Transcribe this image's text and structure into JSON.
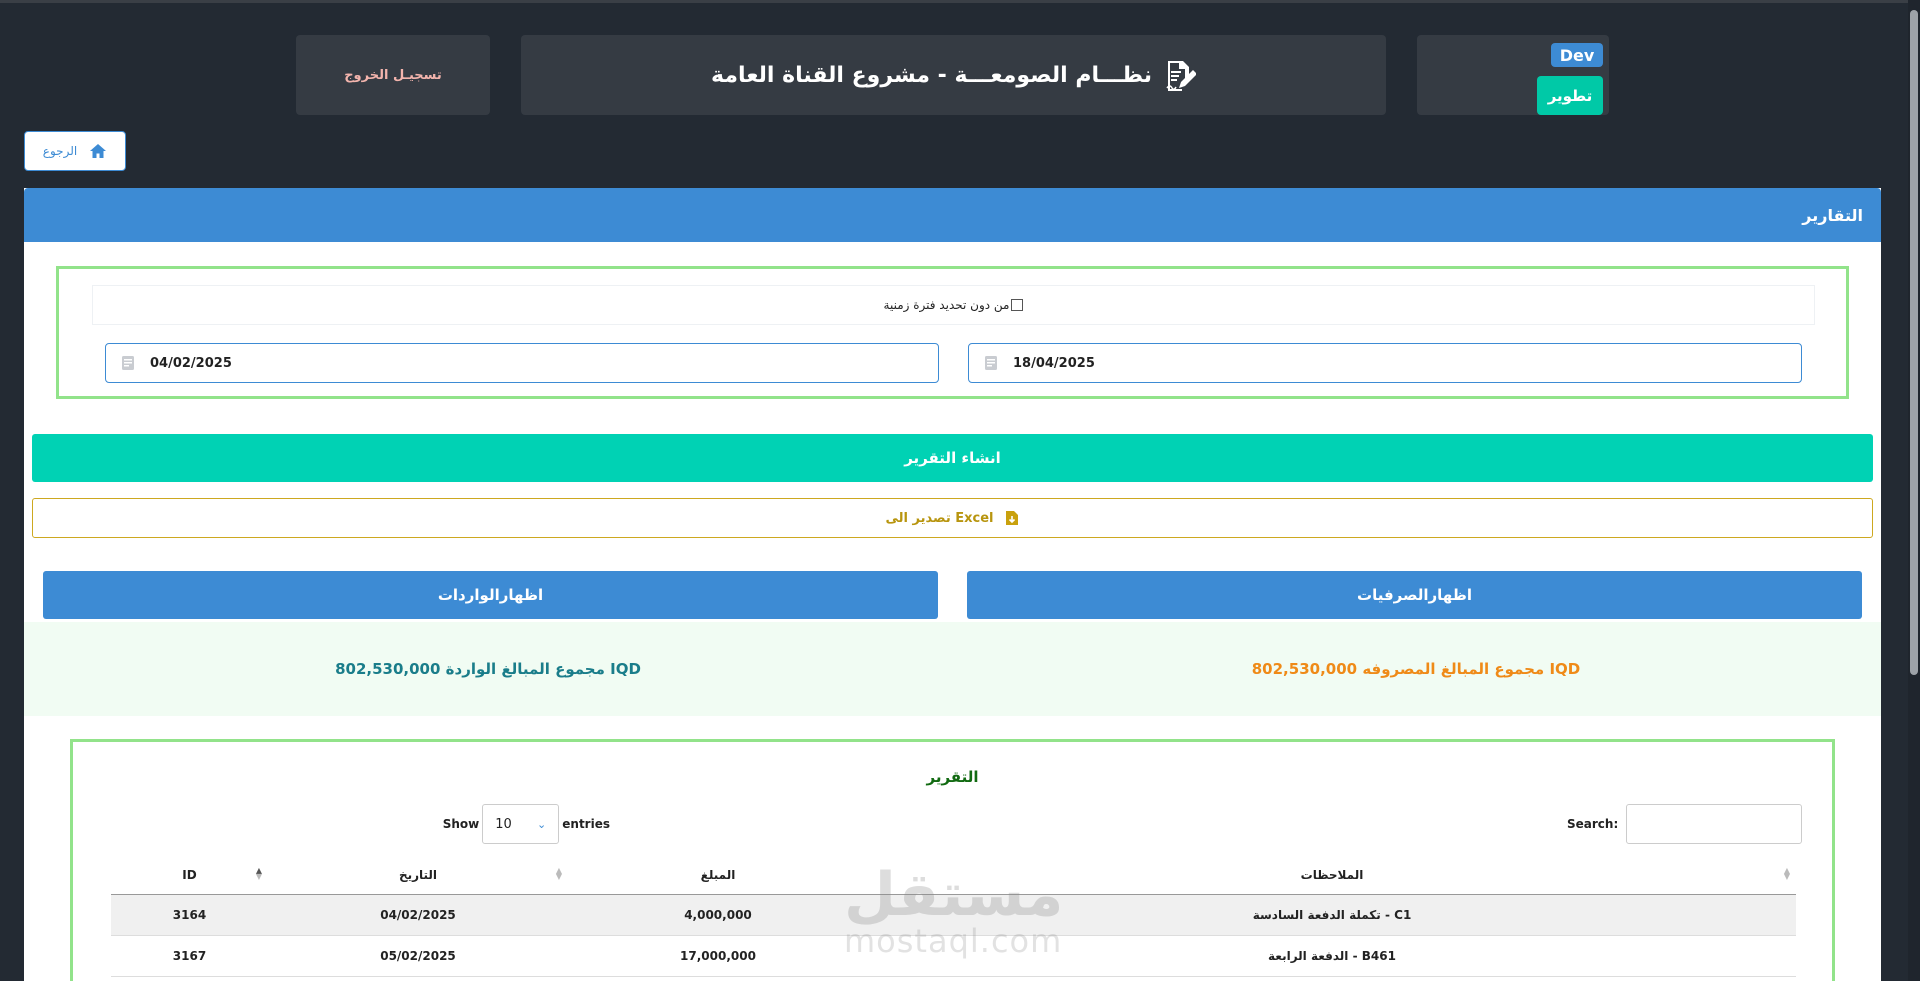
{
  "header": {
    "logout_label": "تسجيـل الخروج",
    "title": "نظـــام الصومعـــة - مشروع القناة العامة",
    "dev_badge": "Dev",
    "dev_button": "تطوير"
  },
  "nav": {
    "back_label": "الرجوع"
  },
  "panel": {
    "title": "التقارير"
  },
  "filters": {
    "no_date_label": "من دون تحديد فترة زمنية",
    "date_from": "04/02/2025",
    "date_to": "18/04/2025"
  },
  "actions": {
    "generate_label": "انشاء التقرير",
    "export_label": "تصدير الى Excel",
    "show_incomes_label": "اظهارالواردات",
    "show_expenses_label": "اظهارالصرفيات"
  },
  "totals": {
    "incomes_text": "مجموع المبالغ الواردة 802,530,000 IQD",
    "expenses_text": "مجموع المبالغ المصروفه 802,530,000 IQD"
  },
  "report": {
    "title": "التقرير",
    "show_label": "Show",
    "entries_value": "10",
    "entries_label": "entries",
    "search_label": "Search:",
    "columns": [
      "ID",
      "التاريخ",
      "المبلغ",
      "الملاحظات"
    ],
    "rows": [
      {
        "id": "3164",
        "date": "04/02/2025",
        "amount": "4,000,000",
        "note": "تكملة الدفعة السادسة - C1"
      },
      {
        "id": "3167",
        "date": "05/02/2025",
        "amount": "17,000,000",
        "note": "الدفعة الرابعة - B461"
      }
    ]
  },
  "watermark": {
    "word": "مستقل",
    "url": "mostaql.com"
  },
  "colors": {
    "background": "#232a33",
    "primary": "#3d8bd4",
    "success": "#00d2b4",
    "warning": "#cda820",
    "outline_green": "#92e38a",
    "income_total": "#1a7d8a",
    "expense_total": "#ef8a17"
  },
  "icons": [
    "edit-document-icon",
    "home-icon",
    "calendar-icon",
    "excel-file-icon",
    "sort-icon",
    "chevron-updown-icon"
  ]
}
